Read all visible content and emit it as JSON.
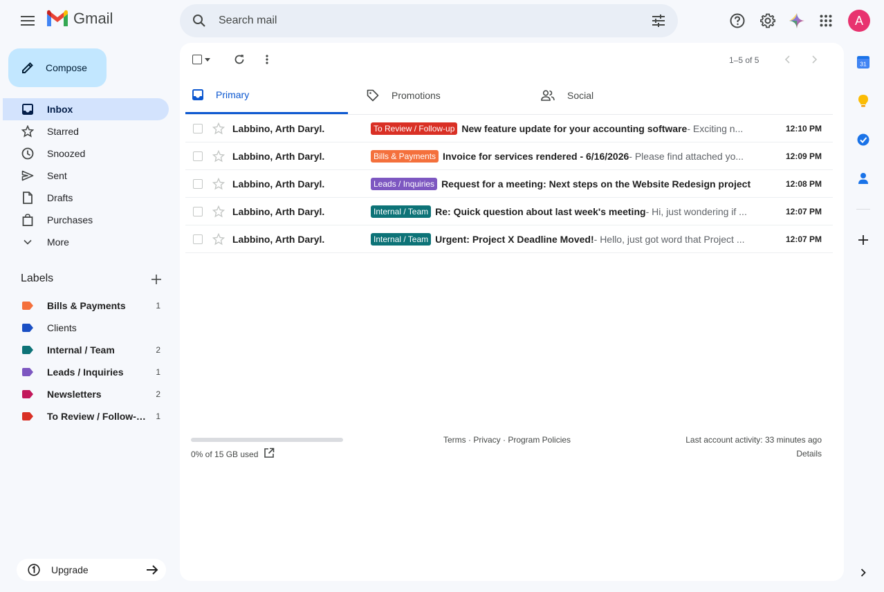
{
  "header": {
    "app_name": "Gmail",
    "search_placeholder": "Search mail",
    "avatar_letter": "A"
  },
  "sidebar": {
    "compose_label": "Compose",
    "items": [
      {
        "label": "Inbox",
        "icon": "inbox-icon",
        "active": true
      },
      {
        "label": "Starred",
        "icon": "star-icon"
      },
      {
        "label": "Snoozed",
        "icon": "clock-icon"
      },
      {
        "label": "Sent",
        "icon": "send-icon"
      },
      {
        "label": "Drafts",
        "icon": "draft-icon"
      },
      {
        "label": "Purchases",
        "icon": "shopping-bag-icon"
      },
      {
        "label": "More",
        "icon": "chevron-down-icon"
      }
    ],
    "labels_title": "Labels",
    "labels": [
      {
        "name": "Bills & Payments",
        "count": "1",
        "color": "#f4703c",
        "bold": true
      },
      {
        "name": "Clients",
        "count": "",
        "color": "#1a4fc4",
        "bold": false
      },
      {
        "name": "Internal / Team",
        "count": "2",
        "color": "#0d7377",
        "bold": true
      },
      {
        "name": "Leads / Inquiries",
        "count": "1",
        "color": "#7d57c1",
        "bold": true
      },
      {
        "name": "Newsletters",
        "count": "2",
        "color": "#c2185b",
        "bold": true
      },
      {
        "name": "To Review / Follow-up",
        "count": "1",
        "color": "#d93025",
        "bold": true
      }
    ],
    "upgrade_label": "Upgrade"
  },
  "toolbar": {
    "pagination": "1–5 of 5"
  },
  "tabs": [
    {
      "label": "Primary",
      "active": true
    },
    {
      "label": "Promotions"
    },
    {
      "label": "Social"
    }
  ],
  "emails": [
    {
      "sender": "Labbino, Arth Daryl.",
      "badge": "To Review / Follow-up",
      "badge_color": "#d93025",
      "subject": "New feature update for your accounting software",
      "snippet": " - Exciting n...",
      "time": "12:10 PM"
    },
    {
      "sender": "Labbino, Arth Daryl.",
      "badge": "Bills & Payments",
      "badge_color": "#f4703c",
      "subject": "Invoice for services rendered - 6/16/2026",
      "snippet": " - Please find attached yo...",
      "time": "12:09 PM"
    },
    {
      "sender": "Labbino, Arth Daryl.",
      "badge": "Leads / Inquiries",
      "badge_color": "#7d57c1",
      "subject": "Request for a meeting: Next steps on the Website Redesign project",
      "snippet": "",
      "time": "12:08 PM"
    },
    {
      "sender": "Labbino, Arth Daryl.",
      "badge": "Internal / Team",
      "badge_color": "#0d7377",
      "subject": "Re: Quick question about last week's meeting",
      "snippet": " - Hi, just wondering if ...",
      "time": "12:07 PM"
    },
    {
      "sender": "Labbino, Arth Daryl.",
      "badge": "Internal / Team",
      "badge_color": "#0d7377",
      "subject": "Urgent: Project X Deadline Moved!",
      "snippet": " - Hello, just got word that Project ...",
      "time": "12:07 PM"
    }
  ],
  "footer": {
    "storage_text": "0% of 15 GB used",
    "storage_fraction": 0.0,
    "links": "Terms · Privacy · Program Policies",
    "last_activity": "Last account activity: 33 minutes ago",
    "details": "Details"
  },
  "rail": {
    "calendar_day": "31"
  }
}
